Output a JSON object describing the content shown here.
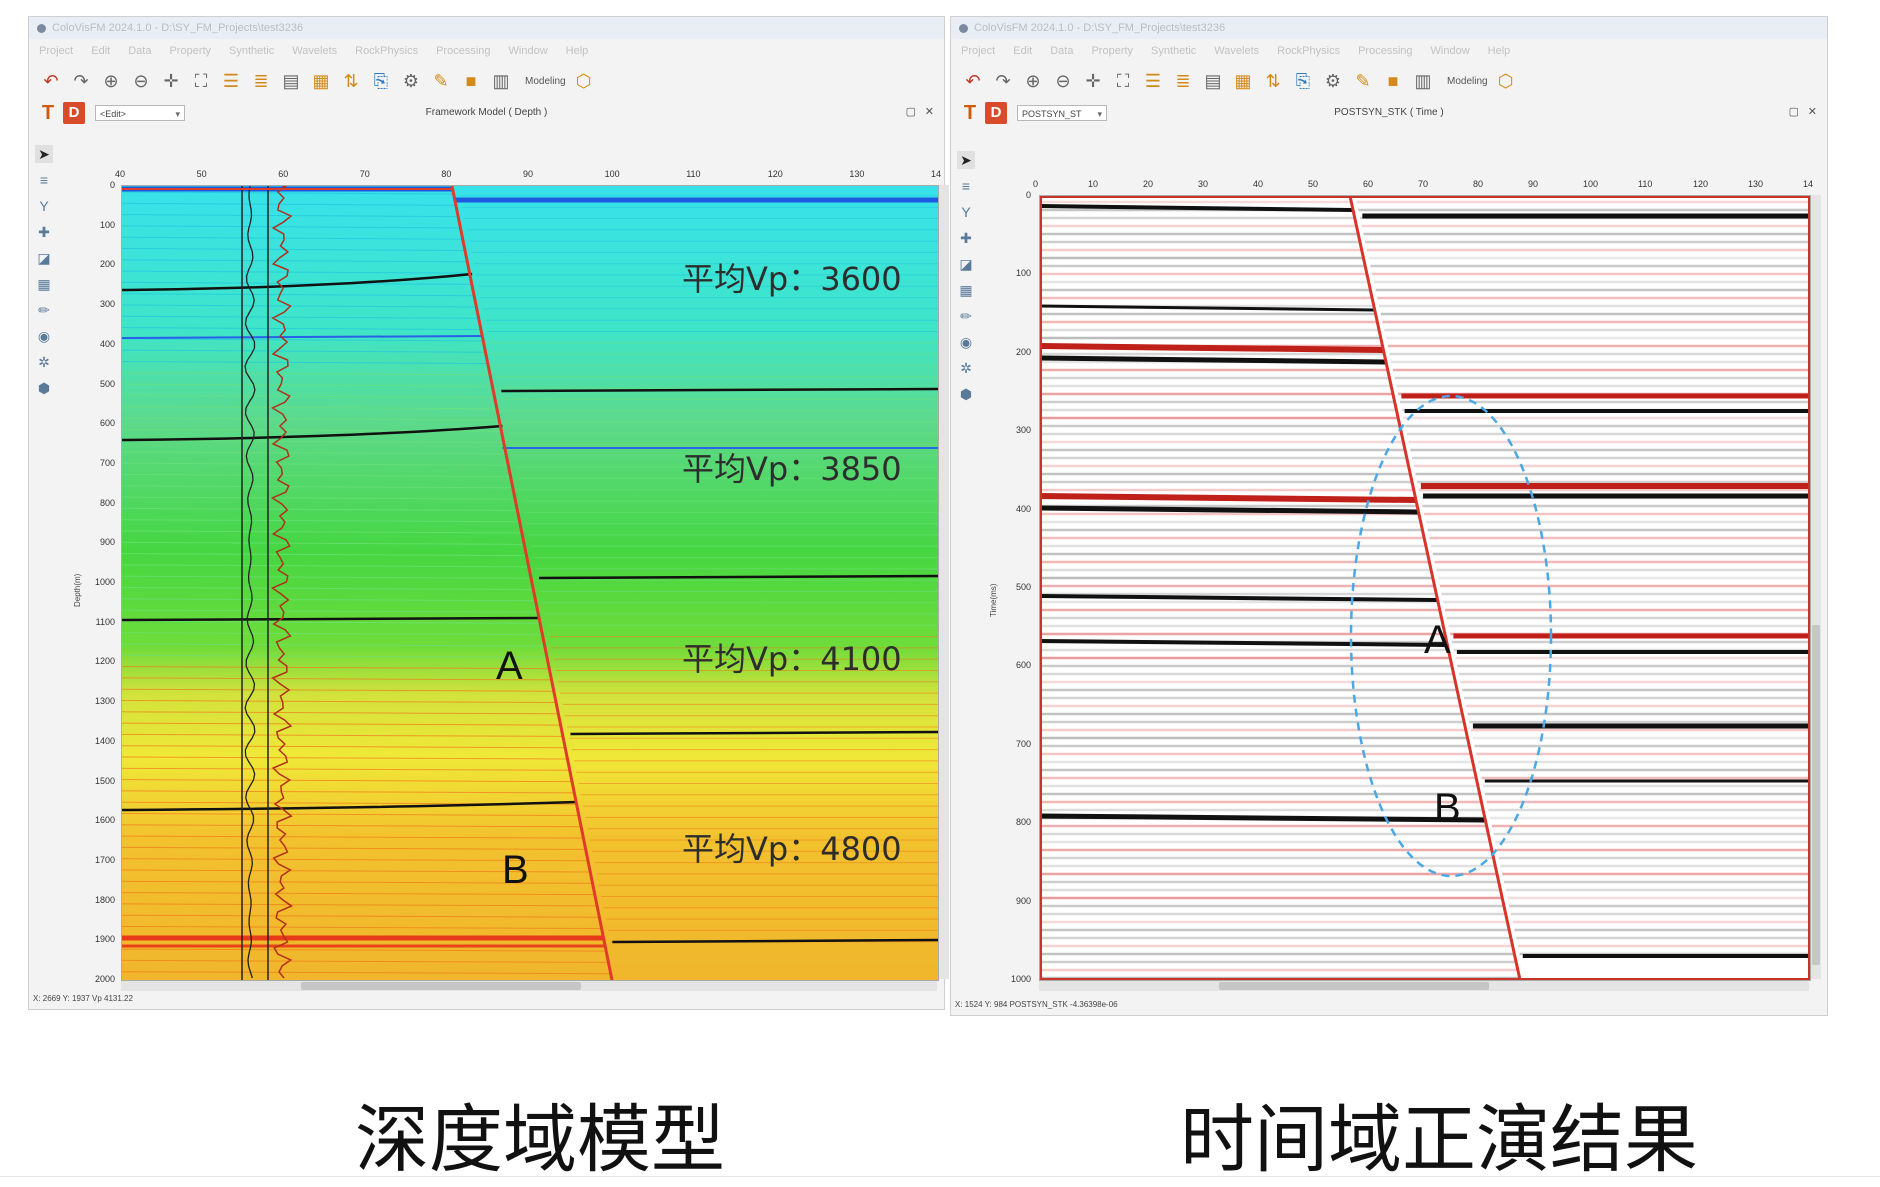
{
  "left_window": {
    "titlebar": "ColoVisFM 2024.1.0 - D:\\SY_FM_Projects\\test3236",
    "menu": [
      "Project",
      "Edit",
      "Data",
      "Property",
      "Synthetic",
      "Wavelets",
      "RockPhysics",
      "Processing",
      "Window",
      "Help"
    ],
    "toolbar_label": "Modeling",
    "mode_dropdown": "<Edit>",
    "panel_title": "Framework Model ( Depth )",
    "axis_left_title": "Depth(m)",
    "x_ticks": [
      "40",
      "50",
      "60",
      "70",
      "80",
      "90",
      "100",
      "110",
      "120",
      "130",
      "14"
    ],
    "y_ticks": [
      "0",
      "100",
      "200",
      "300",
      "400",
      "500",
      "600",
      "700",
      "800",
      "900",
      "1000",
      "1100",
      "1200",
      "1300",
      "1400",
      "1500",
      "1600",
      "1700",
      "1800",
      "1900",
      "2000"
    ],
    "status": "X: 2669 Y: 1937 Vp 4131.22",
    "labels": {
      "A": "A",
      "B": "B"
    },
    "velocity_labels": [
      "平均Vp：3600",
      "平均Vp：3850",
      "平均Vp：4100",
      "平均Vp：4800"
    ]
  },
  "right_window": {
    "titlebar": "ColoVisFM 2024.1.0 - D:\\SY_FM_Projects\\test3236",
    "menu": [
      "Project",
      "Edit",
      "Data",
      "Property",
      "Synthetic",
      "Wavelets",
      "RockPhysics",
      "Processing",
      "Window",
      "Help"
    ],
    "toolbar_label": "Modeling",
    "mode_dropdown": "POSTSYN_ST",
    "panel_title": "POSTSYN_STK ( Time )",
    "axis_left_title": "Time(ms)",
    "x_ticks": [
      "0",
      "10",
      "20",
      "30",
      "40",
      "50",
      "60",
      "70",
      "80",
      "90",
      "100",
      "110",
      "120",
      "130",
      "14"
    ],
    "y_ticks": [
      "0",
      "100",
      "200",
      "300",
      "400",
      "500",
      "600",
      "700",
      "800",
      "900",
      "1000"
    ],
    "status": "X: 1524 Y: 984 POSTSYN_STK -4.36398e-06",
    "labels": {
      "A": "A",
      "B": "B"
    }
  },
  "captions": {
    "left": "深度域模型",
    "right": "时间域正演结果"
  },
  "colors": {
    "fault": "#e03a2a",
    "horizon_black": "#111111",
    "annotation_ellipse": "#4aa8e6"
  }
}
